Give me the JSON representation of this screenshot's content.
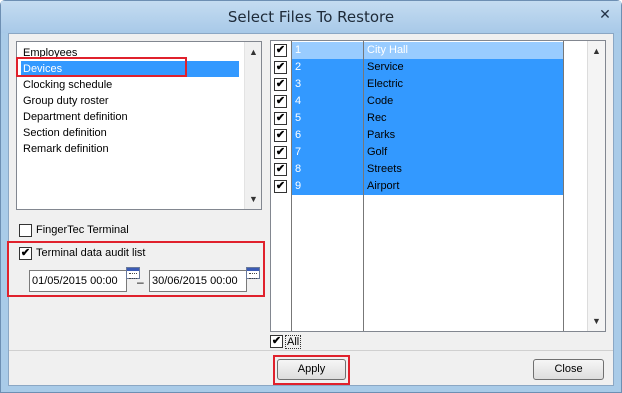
{
  "window": {
    "title": "Select Files To Restore",
    "close_glyph": "✕"
  },
  "file_list": {
    "items": [
      {
        "label": "Employees",
        "selected": false
      },
      {
        "label": "Devices",
        "selected": true
      },
      {
        "label": "Clocking schedule",
        "selected": false
      },
      {
        "label": "Group duty roster",
        "selected": false
      },
      {
        "label": "Department definition",
        "selected": false
      },
      {
        "label": "Section definition",
        "selected": false
      },
      {
        "label": "Remark definition",
        "selected": false
      }
    ],
    "scroll_up": "▲",
    "scroll_down": "▼"
  },
  "fingertec": {
    "label": "FingerTec Terminal",
    "checked": false
  },
  "audit": {
    "label": "Terminal data audit list",
    "checked": true,
    "check_glyph": "✔",
    "date_from": "01/05/2015 00:00",
    "date_to": "30/06/2015 00:00",
    "separator": "–"
  },
  "devices": {
    "rows": [
      {
        "num": "1",
        "name": "City Hall",
        "checked": true
      },
      {
        "num": "2",
        "name": "Service",
        "checked": true
      },
      {
        "num": "3",
        "name": "Electric",
        "checked": true
      },
      {
        "num": "4",
        "name": "Code",
        "checked": true
      },
      {
        "num": "5",
        "name": "Rec",
        "checked": true
      },
      {
        "num": "6",
        "name": "Parks",
        "checked": true
      },
      {
        "num": "7",
        "name": "Golf",
        "checked": true
      },
      {
        "num": "8",
        "name": "Streets",
        "checked": true
      },
      {
        "num": "9",
        "name": "Airport",
        "checked": true
      }
    ],
    "all_label": "All",
    "all_checked": true
  },
  "buttons": {
    "apply": "Apply",
    "close": "Close"
  },
  "colors": {
    "selection": "#3399ff",
    "highlight": "#e0212c",
    "title_bar": "#a9cbe8"
  }
}
